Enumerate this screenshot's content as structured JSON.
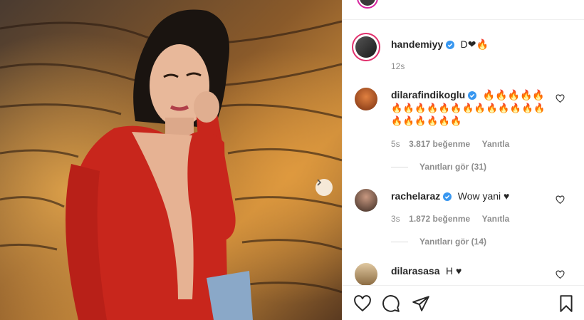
{
  "post": {
    "author": "handemiyy",
    "caption_prefix": "D",
    "caption_emoji": "❤🔥",
    "time": "12s"
  },
  "comments": [
    {
      "user": "dilarafindikoglu",
      "verified": true,
      "text_line1": "🔥🔥🔥🔥🔥",
      "text_line2": "🔥🔥🔥🔥🔥🔥🔥🔥🔥🔥🔥🔥🔥",
      "text_line3": "🔥🔥🔥🔥🔥🔥",
      "time": "5s",
      "likes": "3.817 beğenme",
      "reply": "Yanıtla",
      "view_replies": "Yanıtları gör (31)"
    },
    {
      "user": "rachelaraz",
      "verified": true,
      "text": "Wow yani ♥",
      "time": "3s",
      "likes": "1.872 beğenme",
      "reply": "Yanıtla",
      "view_replies": "Yanıtları gör (14)"
    },
    {
      "user": "dilarasasa",
      "verified": false,
      "text": "H ♥"
    }
  ],
  "icons": {
    "like": "heart-icon",
    "comment": "comment-icon",
    "share": "paper-plane-icon",
    "save": "bookmark-icon",
    "verified": "verified-badge-icon",
    "next": "chevron-right-icon"
  },
  "colors": {
    "verified": "#3897f0",
    "muted": "#8e8e8e",
    "text": "#262626",
    "dress": "#c8261c"
  }
}
